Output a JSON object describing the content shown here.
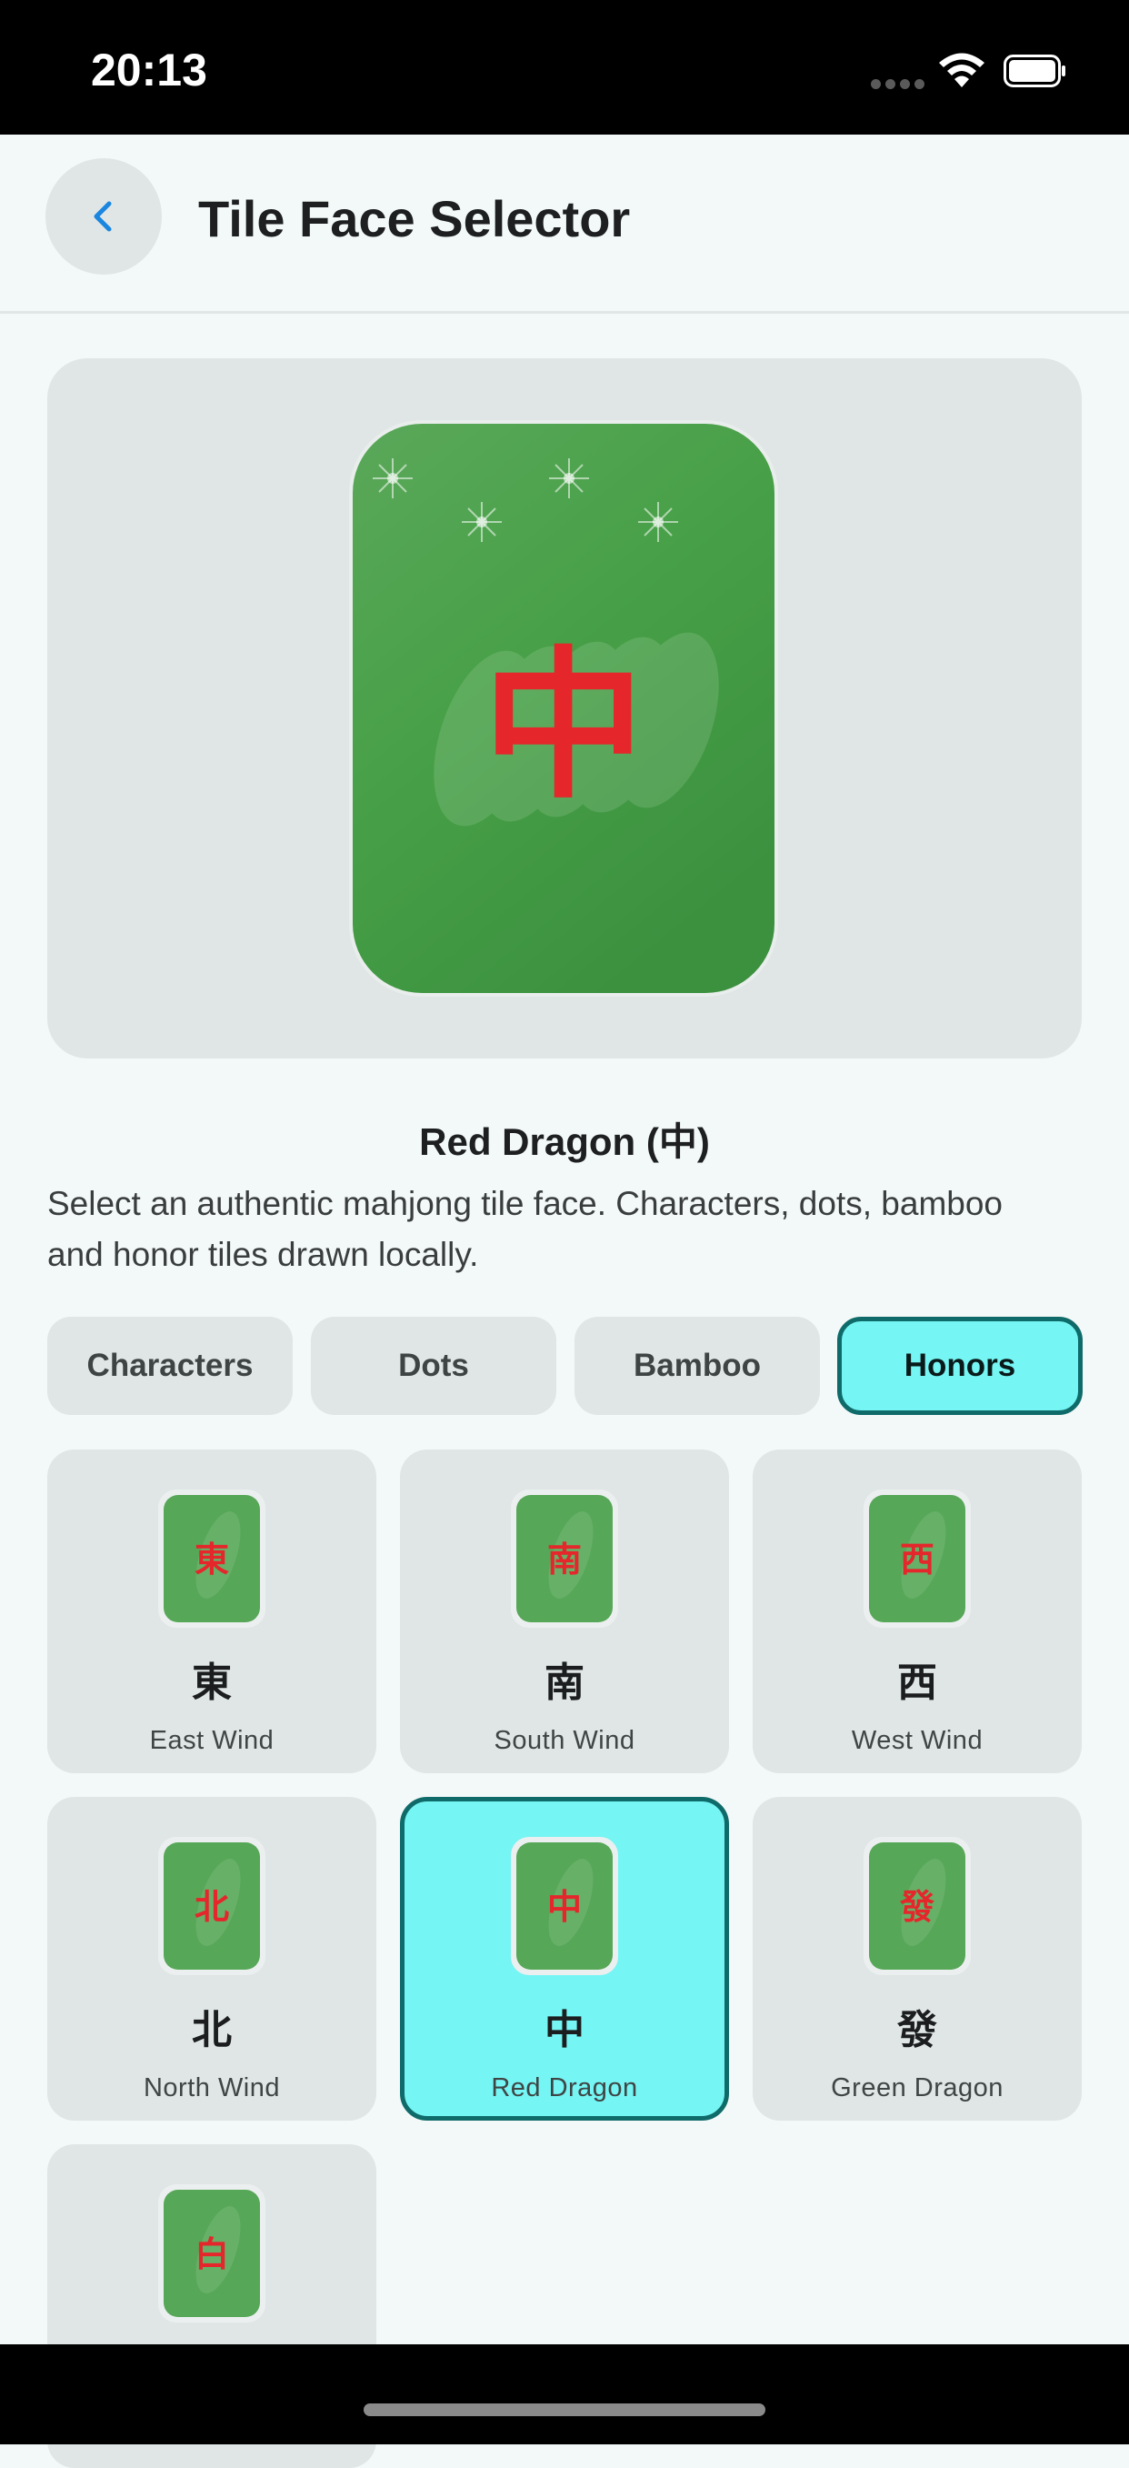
{
  "status_bar": {
    "time": "20:13"
  },
  "header": {
    "title": "Tile Face Selector"
  },
  "preview": {
    "glyph": "中",
    "name": "Red Dragon (中)"
  },
  "description": "Select an authentic mahjong tile face. Characters, dots, bamboo and honor tiles drawn locally.",
  "categories": [
    {
      "label": "Characters"
    },
    {
      "label": "Dots"
    },
    {
      "label": "Bamboo"
    },
    {
      "label": "Honors",
      "selected": true
    }
  ],
  "tiles": [
    {
      "glyph": "東",
      "label": "East Wind"
    },
    {
      "glyph": "南",
      "label": "South Wind"
    },
    {
      "glyph": "西",
      "label": "West Wind"
    },
    {
      "glyph": "北",
      "label": "North Wind"
    },
    {
      "glyph": "中",
      "label": "Red Dragon",
      "selected": true
    },
    {
      "glyph": "發",
      "label": "Green Dragon"
    },
    {
      "glyph": "白",
      "label": ""
    }
  ],
  "colors": {
    "tile_green": "#46a047",
    "tile_red": "#e5262b",
    "selected_fill": "#75f5f3",
    "selected_border": "#0f6b6a",
    "accent_blue": "#1a86e0"
  }
}
